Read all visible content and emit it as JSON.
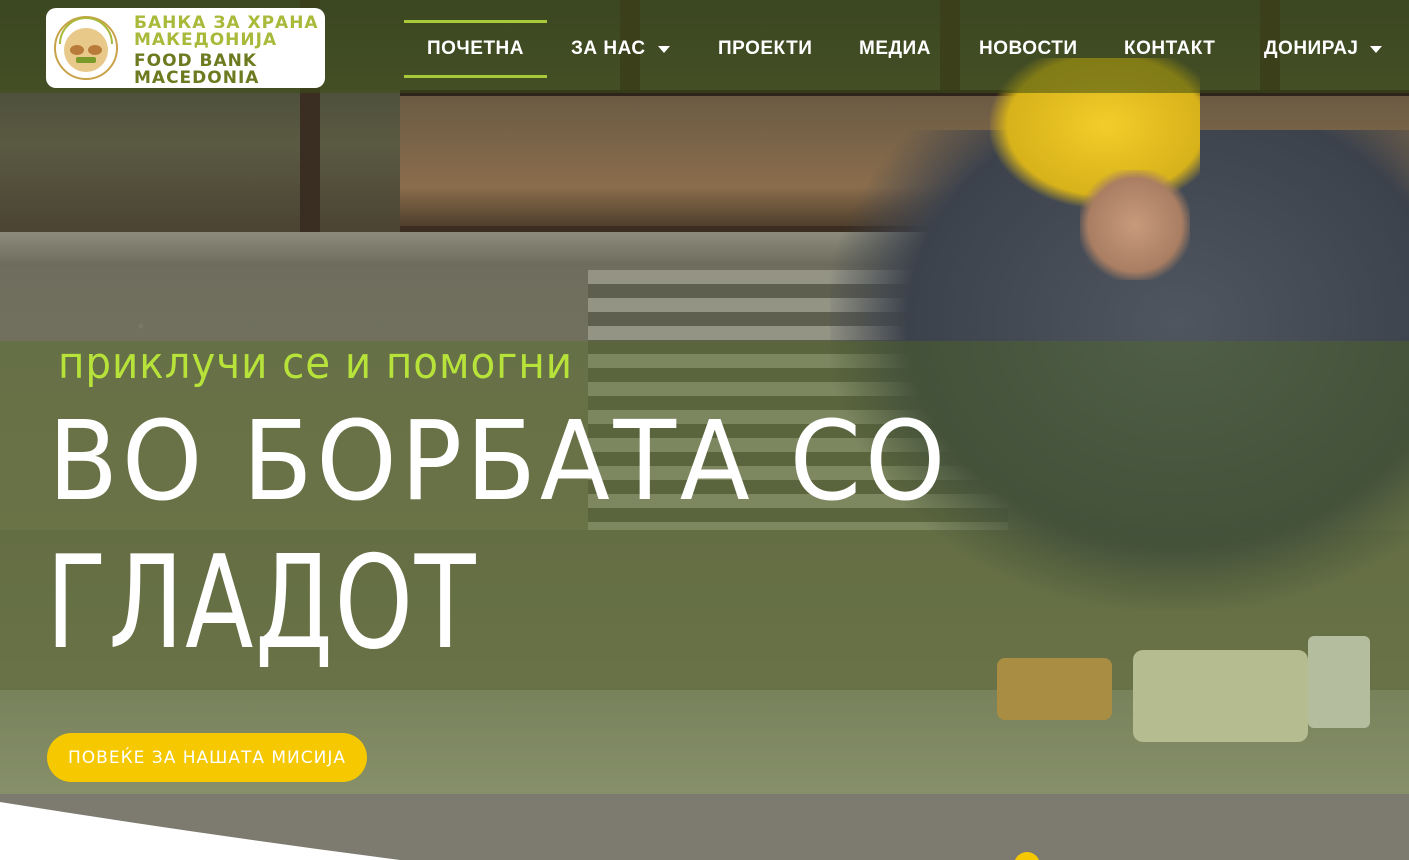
{
  "brand": {
    "line1": "БАНКА ЗА ХРАНА",
    "line2": "МАКЕДОНИЈА",
    "line3": "FOOD BANK",
    "line4": "MACEDONIA",
    "emblem_top_text": "Банка за храна Македонија",
    "emblem_bottom_text": "Food Bank Macedonia",
    "colors": {
      "accent_green": "#a9b93a",
      "dark_green": "#6e7a1f",
      "cta_yellow": "#f5c800"
    }
  },
  "nav": {
    "items": [
      {
        "label": "ПОЧЕТНА",
        "active": true
      },
      {
        "label": "ЗА НАС",
        "has_dropdown": true,
        "icon": "caret-down-icon"
      },
      {
        "label": "ПРОЕКТИ"
      },
      {
        "label": "МЕДИА"
      },
      {
        "label": "НОВОСТИ"
      },
      {
        "label": "КОНТАКТ"
      },
      {
        "label": "ДОНИРАЈ",
        "has_dropdown": true,
        "icon": "caret-down-icon"
      }
    ]
  },
  "hero": {
    "tagline": "приклучи се и помогни",
    "headline_line1": "ВО БОРБАТА СО",
    "headline_line2": "ГЛАДОТ",
    "cta_label": "ПОВЕЌЕ ЗА НАШАТА МИСИЈА"
  }
}
